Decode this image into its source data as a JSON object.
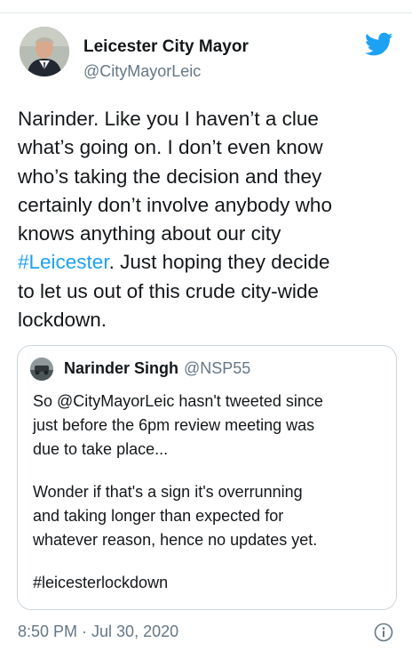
{
  "author": {
    "name": "Leicester City Mayor",
    "handle": "@CityMayorLeic"
  },
  "tweet": {
    "line1": "Narinder. Like you I haven’t a clue",
    "line2": "what’s going on. I don’t even know",
    "line3": "who’s taking the decision and they",
    "line4": "certainly don’t involve anybody who",
    "line5": "knows anything about our city",
    "hashtag": "#Leicester",
    "line6_rest": ". Just hoping they decide",
    "line7": "to let us out of this crude city-wide",
    "line8": "lockdown."
  },
  "quoted": {
    "name": "Narinder Singh",
    "handle": "@NSP55",
    "line1": "So @CityMayorLeic hasn't tweeted since",
    "line2": "just before the 6pm review meeting was",
    "line3": "due to take place...",
    "line4": "Wonder if that's a sign it's overrunning",
    "line5": "and taking longer than expected for",
    "line6": "whatever reason, hence no updates yet.",
    "line7": "#leicesterlockdown"
  },
  "timestamp": "8:50 PM · Jul 30, 2020",
  "colors": {
    "link": "#1da1f2",
    "secondary_text": "#657786",
    "primary_text": "#14171a",
    "border": "#ccd6dd"
  },
  "icons": {
    "brand": "twitter-bird-icon",
    "info": "info-icon"
  }
}
